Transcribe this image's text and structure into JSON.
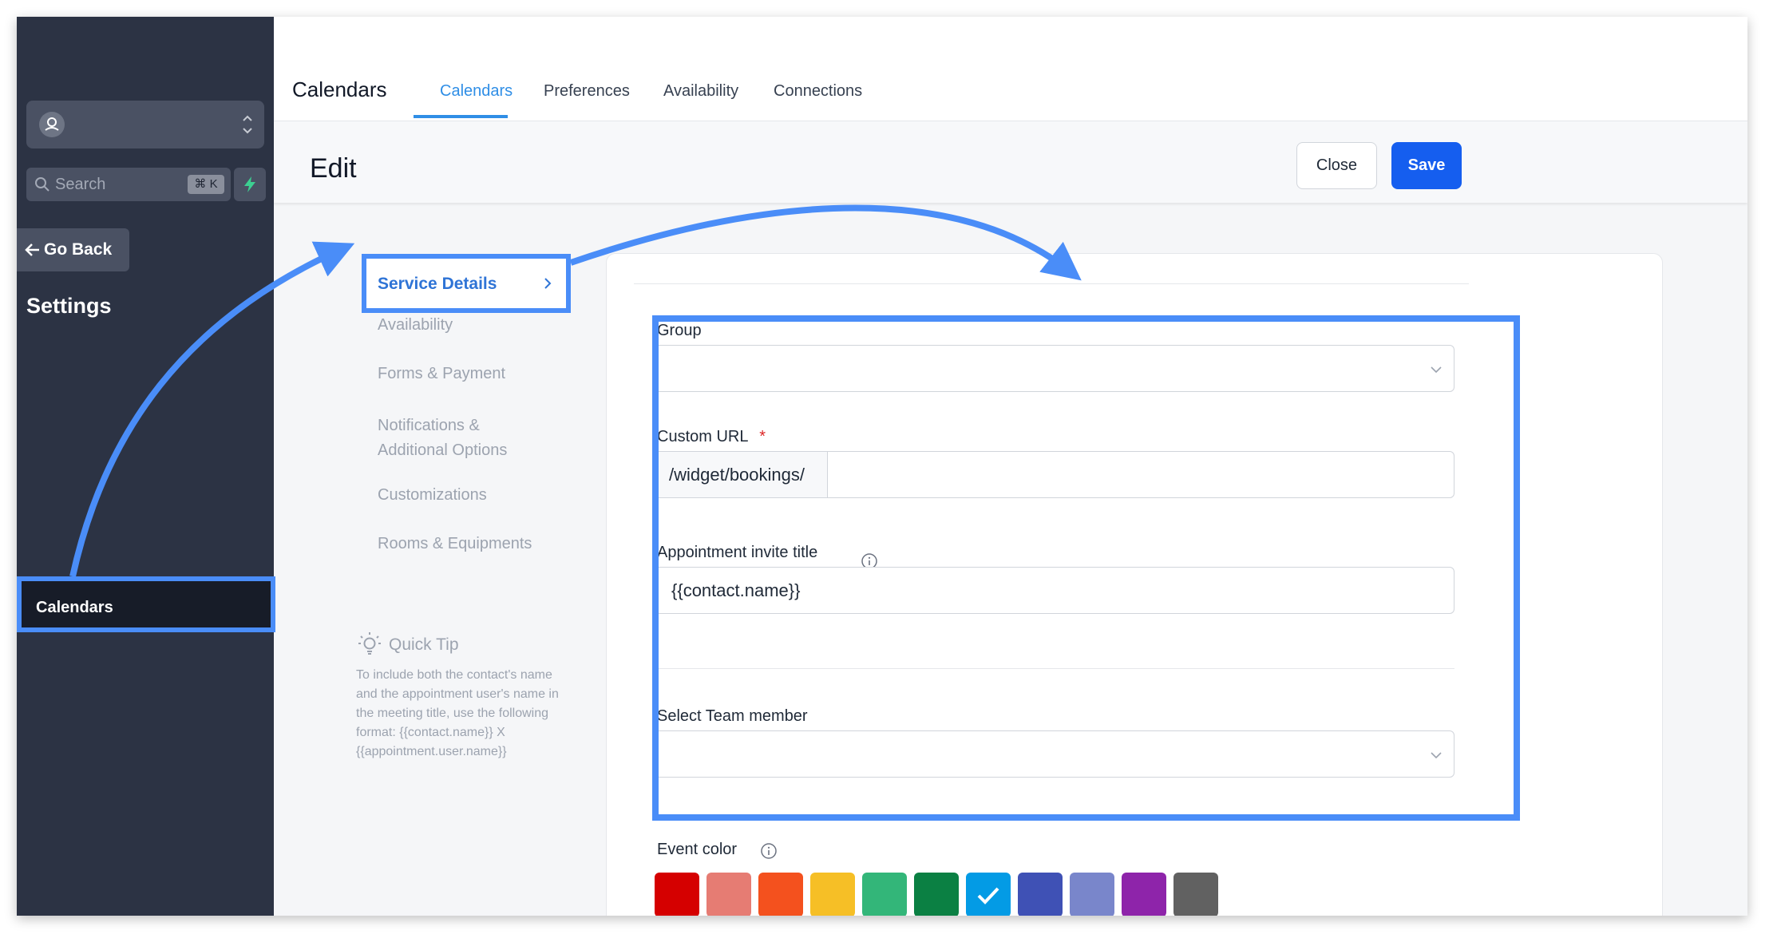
{
  "sidebar": {
    "search": {
      "placeholder": "Search",
      "shortcut": "⌘ K"
    },
    "go_back": "Go Back",
    "settings_title": "Settings",
    "active_item": "Calendars"
  },
  "header": {
    "app_title": "Calendars",
    "tabs": [
      {
        "label": "Calendars",
        "active": true
      },
      {
        "label": "Preferences",
        "active": false
      },
      {
        "label": "Availability",
        "active": false
      },
      {
        "label": "Connections",
        "active": false
      }
    ]
  },
  "editbar": {
    "title": "Edit",
    "close_label": "Close",
    "save_label": "Save"
  },
  "section_nav": {
    "items": [
      "Service Details",
      "Availability",
      "Forms & Payment",
      "Notifications &\nAdditional Options",
      "Customizations",
      "Rooms & Equipments"
    ],
    "active_index": 0
  },
  "quick_tip": {
    "title": "Quick Tip",
    "text": "To include both the contact's name and the appointment user's name in the meeting title, use the following format: {{contact.name}} X {{appointment.user.name}}"
  },
  "form": {
    "group": {
      "label": "Group",
      "value": ""
    },
    "custom_url": {
      "label": "Custom URL",
      "required_mark": "*",
      "prefix": "/widget/bookings/",
      "value": ""
    },
    "invite_title": {
      "label": "Appointment invite title",
      "value": "{{contact.name}}"
    },
    "team_member": {
      "label": "Select Team member",
      "value": ""
    },
    "event_color": {
      "label": "Event color",
      "colors": [
        "#d50000",
        "#e67c73",
        "#f4511e",
        "#f6bf26",
        "#33b679",
        "#0b8043",
        "#039be5",
        "#3f51b5",
        "#7986cb",
        "#8e24aa",
        "#616161"
      ],
      "selected_index": 6
    }
  }
}
